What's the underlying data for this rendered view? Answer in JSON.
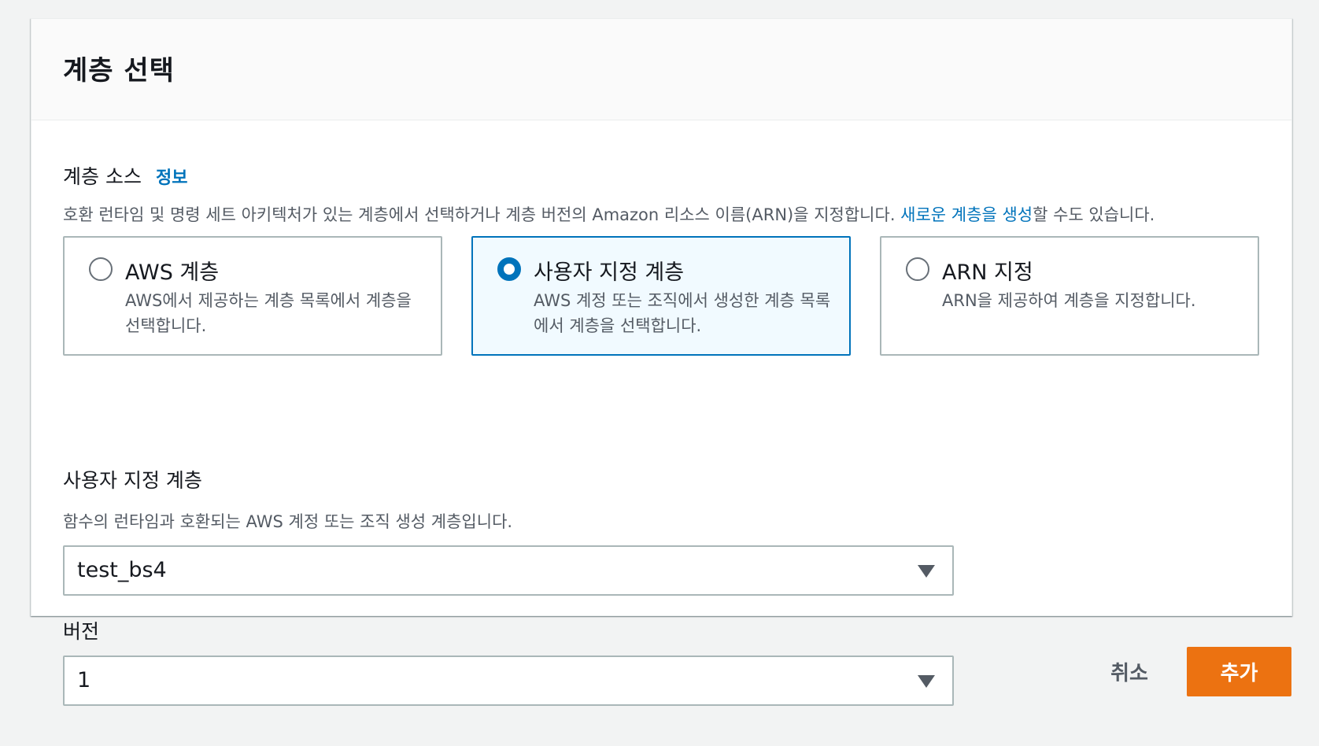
{
  "panel": {
    "title": "계층 선택"
  },
  "layer_source": {
    "label": "계층 소스",
    "info_link": "정보",
    "description_before": "호환 런타임 및 명령 세트 아키텍처가 있는 계층에서 선택하거나 계층 버전의 Amazon 리소스 이름(ARN)을 지정합니다. ",
    "description_link": "새로운 계층을 생성",
    "description_after": "할 수도 있습니다.",
    "options": [
      {
        "title": "AWS 계층",
        "description": "AWS에서 제공하는 계층 목록에서 계층을 선택합니다.",
        "selected": false
      },
      {
        "title": "사용자 지정 계층",
        "description": "AWS 계정 또는 조직에서 생성한 계층 목록에서 계층을 선택합니다.",
        "selected": true
      },
      {
        "title": "ARN 지정",
        "description": "ARN을 제공하여 계층을 지정합니다.",
        "selected": false
      }
    ]
  },
  "custom_layer": {
    "label": "사용자 지정 계층",
    "description": "함수의 런타임과 호환되는 AWS 계정 또는 조직 생성 계층입니다.",
    "selected_value": "test_bs4"
  },
  "version": {
    "label": "버전",
    "selected_value": "1"
  },
  "footer": {
    "cancel_label": "취소",
    "add_label": "추가"
  },
  "colors": {
    "accent": "#0073bb",
    "primary_button": "#ec7211",
    "page_background": "#f2f3f3"
  }
}
